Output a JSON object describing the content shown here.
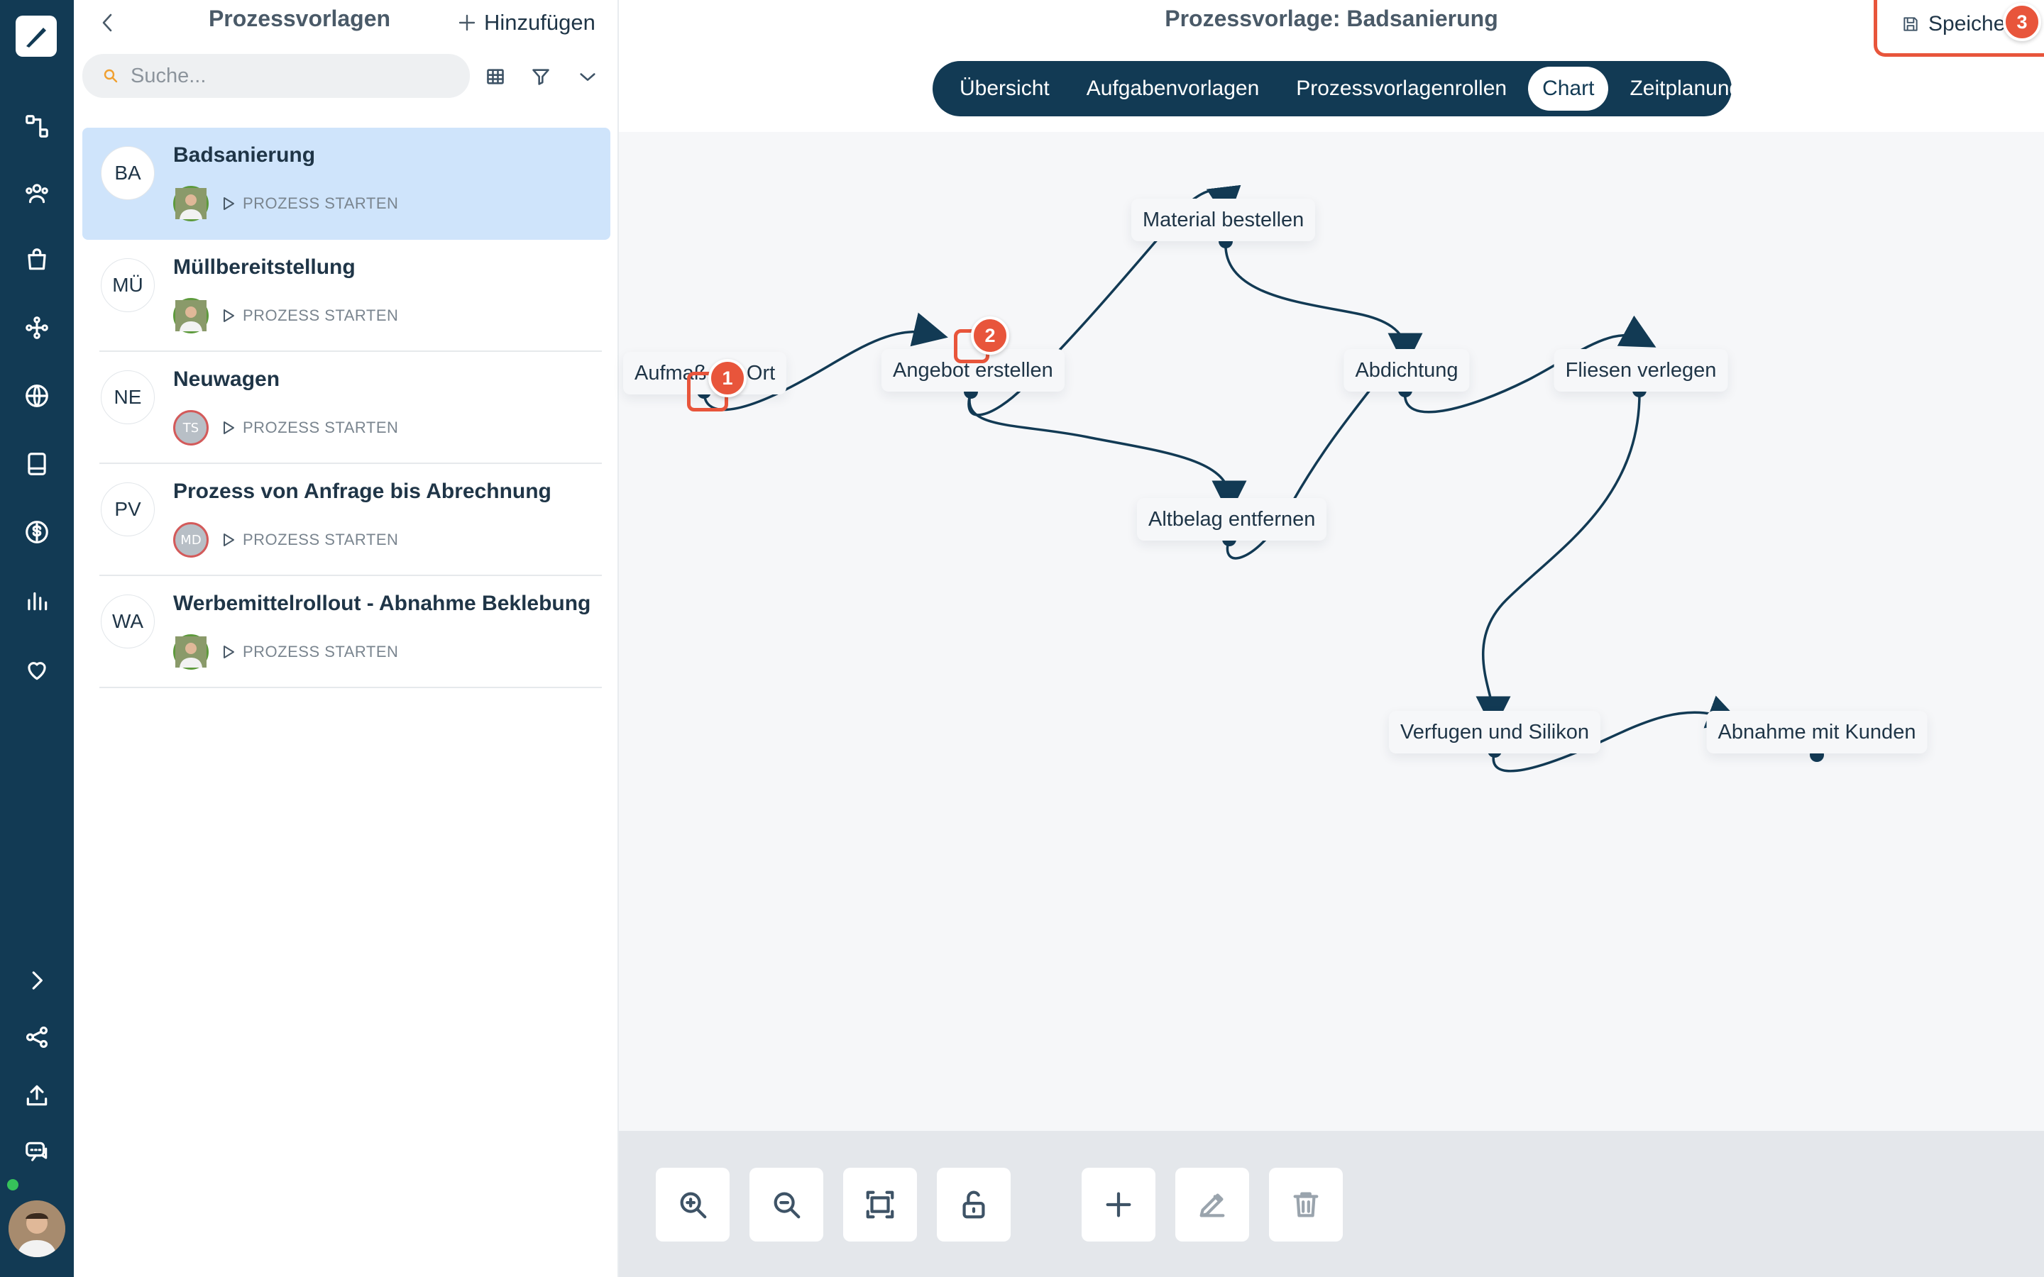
{
  "sidebar": {
    "title": "Prozessvorlagen",
    "add_label": "Hinzufügen",
    "search_placeholder": "Suche...",
    "items": [
      {
        "abbr": "BA",
        "title": "Badsanierung",
        "start": "PROZESS STARTEN",
        "avatar": "photo"
      },
      {
        "abbr": "MÜ",
        "title": "Müllbereitstellung",
        "start": "PROZESS STARTEN",
        "avatar": "photo"
      },
      {
        "abbr": "NE",
        "title": "Neuwagen",
        "start": "PROZESS STARTEN",
        "avatar_initials": "TS"
      },
      {
        "abbr": "PV",
        "title": "Prozess von Anfrage bis Abrechnung",
        "start": "PROZESS STARTEN",
        "avatar_initials": "MD"
      },
      {
        "abbr": "WA",
        "title": "Werbemittelrollout - Abnahme Beklebung",
        "start": "PROZESS STARTEN",
        "avatar": "photo"
      }
    ]
  },
  "main": {
    "title": "Prozessvorlage: Badsanierung",
    "save_label": "Speiche",
    "tabs": [
      "Übersicht",
      "Aufgabenvorlagen",
      "Prozessvorlagenrollen",
      "Chart",
      "Zeitplanung"
    ],
    "active_tab": "Chart"
  },
  "chart": {
    "nodes": {
      "aufmass": "Aufmaß vor Ort",
      "angebot": "Angebot erstellen",
      "material": "Material bestellen",
      "abdichtung": "Abdichtung",
      "fliesen": "Fliesen verlegen",
      "altbelag": "Altbelag entfernen",
      "verfugen": "Verfugen und Silikon",
      "abnahme": "Abnahme mit Kunden"
    },
    "badges": [
      "1",
      "2",
      "3"
    ]
  },
  "colors": {
    "rail": "#123a54",
    "accent": "#e8553b",
    "active_item": "#cfe4fb"
  }
}
